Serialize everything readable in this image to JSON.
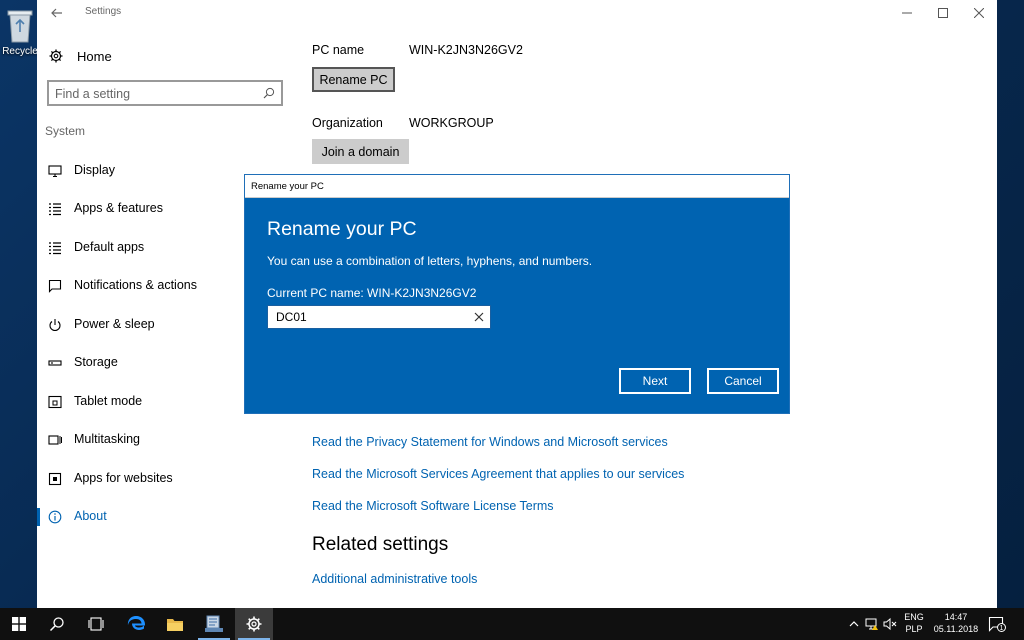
{
  "desktop": {
    "recycle_label": "Recycle"
  },
  "window": {
    "title": "Settings"
  },
  "sidebar": {
    "home_label": "Home",
    "search_placeholder": "Find a setting",
    "section_label": "System",
    "items": [
      {
        "label": "Display",
        "icon": "monitor-icon"
      },
      {
        "label": "Apps & features",
        "icon": "list-icon"
      },
      {
        "label": "Default apps",
        "icon": "list-icon"
      },
      {
        "label": "Notifications & actions",
        "icon": "message-icon"
      },
      {
        "label": "Power & sleep",
        "icon": "power-icon"
      },
      {
        "label": "Storage",
        "icon": "storage-icon"
      },
      {
        "label": "Tablet mode",
        "icon": "tablet-icon"
      },
      {
        "label": "Multitasking",
        "icon": "multitask-icon"
      },
      {
        "label": "Apps for websites",
        "icon": "app-web-icon"
      },
      {
        "label": "About",
        "icon": "info-icon",
        "active": true
      }
    ]
  },
  "content": {
    "pc_name_label": "PC name",
    "pc_name_value": "WIN-K2JN3N26GV2",
    "rename_button": "Rename PC",
    "organization_label": "Organization",
    "organization_value": "WORKGROUP",
    "join_domain_button": "Join a domain",
    "links": [
      "Read the Privacy Statement for Windows and Microsoft services",
      "Read the Microsoft Services Agreement that applies to our services",
      "Read the Microsoft Software License Terms"
    ],
    "related_heading": "Related settings",
    "related_links": [
      "Additional administrative tools"
    ]
  },
  "dialog": {
    "title": "Rename your PC",
    "heading": "Rename your PC",
    "description": "You can use a combination of letters, hyphens, and numbers.",
    "current_name": "Current PC name: WIN-K2JN3N26GV2",
    "input_value": "DC01",
    "next_button": "Next",
    "cancel_button": "Cancel"
  },
  "taskbar": {
    "language_top": "ENG",
    "language_bottom": "PLP",
    "time": "14:47",
    "date": "05.11.2018",
    "notification_count": "1",
    "accent_color": "#7eb4ea"
  },
  "colors": {
    "accent": "#0063b1",
    "dialog_bg": "#0063b1",
    "taskbar_bg": "#101010"
  }
}
